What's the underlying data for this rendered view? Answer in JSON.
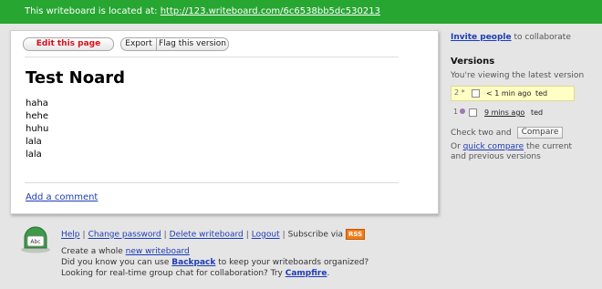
{
  "topbar": {
    "text": "This writeboard is located at:",
    "url": "http://123.writeboard.com/6c6538bb5dc530213"
  },
  "toolbar": {
    "edit_label": "Edit this page",
    "export_label": "Export",
    "flag_label": "Flag this version"
  },
  "document": {
    "title": "Test Noard",
    "lines": [
      "haha",
      "hehe",
      "huhu",
      "lala",
      "lala"
    ],
    "add_comment": "Add a comment"
  },
  "sidebar": {
    "invite_link": "Invite people",
    "invite_suffix": "to collaborate",
    "versions_title": "Versions",
    "versions_note": "You're viewing the latest version",
    "versions": [
      {
        "marker": "2 *",
        "time": "< 1 min ago",
        "author": "ted",
        "current": true
      },
      {
        "marker": "1",
        "time": "9 mins ago",
        "author": "ted",
        "current": false
      }
    ],
    "check_two": "Check two and",
    "compare_button": "Compare",
    "or_prefix": "Or",
    "quick_compare": "quick compare",
    "or_suffix": "the current and previous versions"
  },
  "footer": {
    "logo_text": "Abc",
    "links": {
      "help": "Help",
      "change_password": "Change password",
      "delete_writeboard": "Delete writeboard",
      "logout": "Logout",
      "subscribe": "Subscribe via",
      "rss": "RSS"
    },
    "create_prefix": "Create a whole",
    "new_writeboard": "new writeboard",
    "backpack_prefix": "Did you know you can use",
    "backpack": "Backpack",
    "backpack_suffix": "to keep your writeboards organized?",
    "campfire_prefix": "Looking for real-time group chat for collaboration? Try",
    "campfire": "Campfire",
    "campfire_suffix": "."
  },
  "colors": {
    "topbar": "#27a632",
    "link": "#1c3cb8",
    "edit_button_text": "#d8101a",
    "highlight": "#ffffc4",
    "rss": "#f27c1a"
  }
}
